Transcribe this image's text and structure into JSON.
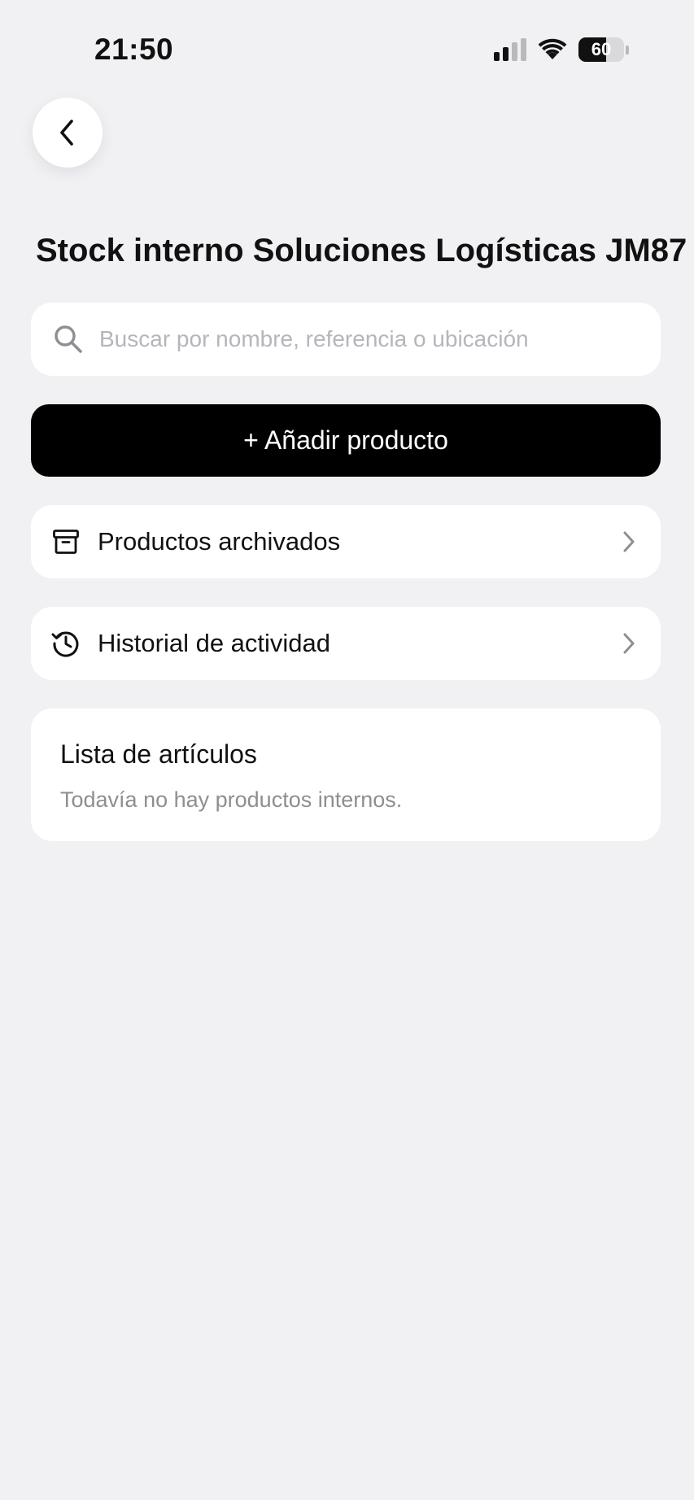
{
  "status_bar": {
    "time": "21:50",
    "battery_percent": "60",
    "battery_level": 0.6,
    "signal_bars_active": 2,
    "icons": [
      "signal-icon",
      "wifi-icon",
      "battery-icon"
    ]
  },
  "nav": {
    "back_icon": "chevron-left-icon"
  },
  "page": {
    "title": "Stock interno Soluciones Logísticas JM87"
  },
  "search": {
    "placeholder": "Buscar por nombre, referencia o ubicación",
    "value": "",
    "icon": "search-icon"
  },
  "add_button": {
    "label": "+ Añadir producto"
  },
  "menu": {
    "archived": {
      "label": "Productos archivados",
      "icon": "archive-box-icon"
    },
    "history": {
      "label": "Historial de actividad",
      "icon": "history-icon"
    }
  },
  "items_list": {
    "heading": "Lista de artículos",
    "empty_message": "Todavía no hay productos internos."
  },
  "colors": {
    "background": "#f1f1f4",
    "card": "#ffffff",
    "primary": "#000000",
    "muted_text": "#8e8e93",
    "placeholder": "#b5b5bb"
  }
}
